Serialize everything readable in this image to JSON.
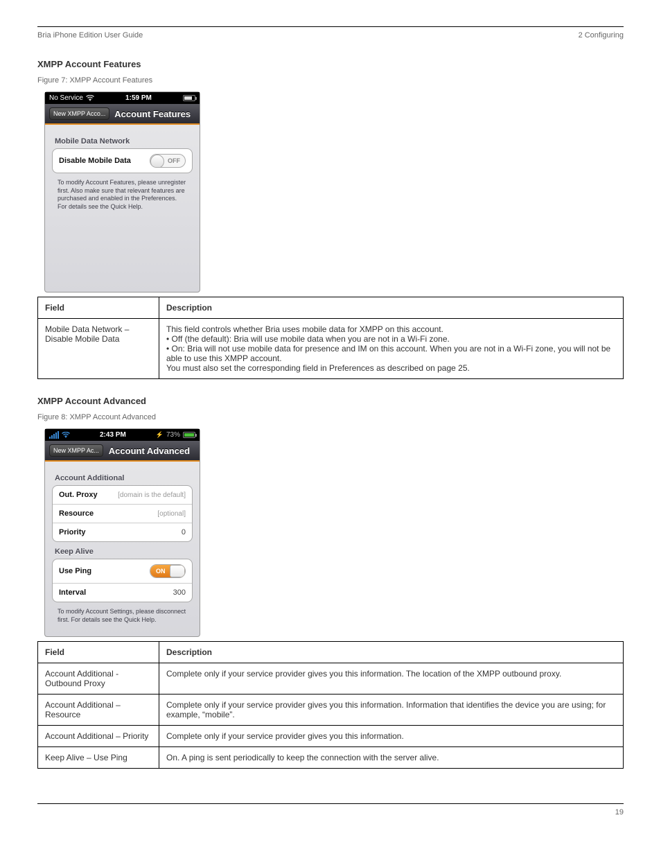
{
  "header": {
    "left": "Bria iPhone Edition User Guide",
    "right": "2 Configuring"
  },
  "section1": {
    "title": "XMPP Account Features",
    "caption": "Figure 7: XMPP Account Features",
    "shot": {
      "status_left": "No Service",
      "time": "1:59 PM",
      "back": "New XMPP Acco...",
      "nav_title": "Account Features",
      "group_header": "Mobile Data Network",
      "row_label": "Disable Mobile Data",
      "toggle_text": "OFF",
      "footnote": "To modify Account Features, please unregister first. Also make sure that relevant features are purchased and enabled in the Preferences. For details see the Quick Help."
    },
    "table": {
      "h1": "Field",
      "h2": "Description",
      "rows": [
        {
          "field": "Mobile Data Network – Disable Mobile Data",
          "desc": "This field controls whether Bria uses mobile data for XMPP on this account.\n• Off (the default): Bria will use mobile data when you are not in a Wi-Fi zone.\n• On: Bria will not use mobile data for presence and IM on this account. When you are not in a Wi-Fi zone, you will not be able to use this XMPP account.\nYou must also set the corresponding field in Preferences as described on page 25."
        }
      ]
    }
  },
  "section2": {
    "title": "XMPP Account Advanced",
    "caption": "Figure 8: XMPP Account Advanced",
    "shot": {
      "time": "2:43 PM",
      "battery_pct": "73%",
      "back": "New XMPP Ac...",
      "nav_title": "Account Advanced",
      "group1_header": "Account Additional",
      "out_proxy_label": "Out. Proxy",
      "out_proxy_ph": "[domain is the default]",
      "resource_label": "Resource",
      "resource_ph": "[optional]",
      "priority_label": "Priority",
      "priority_value": "0",
      "group2_header": "Keep Alive",
      "use_ping_label": "Use Ping",
      "toggle_text": "ON",
      "interval_label": "Interval",
      "interval_value": "300",
      "footnote": "To modify Account Settings, please disconnect first.  For details see the Quick Help."
    },
    "table": {
      "h1": "Field",
      "h2": "Description",
      "rows": [
        {
          "field": "Account Additional - Outbound Proxy",
          "desc": "Complete only if your service provider gives you this information. The location of the XMPP outbound proxy."
        },
        {
          "field": "Account Additional – Resource",
          "desc": "Complete only if your service provider gives you this information. Information that identifies the device you are using; for example, “mobile”."
        },
        {
          "field": "Account Additional – Priority",
          "desc": "Complete only if your service provider gives you this information."
        },
        {
          "field": "Keep Alive – Use Ping",
          "desc": "On. A ping is sent periodically to keep the connection with the server alive."
        }
      ]
    }
  },
  "footer": {
    "left": "",
    "right": "19"
  }
}
